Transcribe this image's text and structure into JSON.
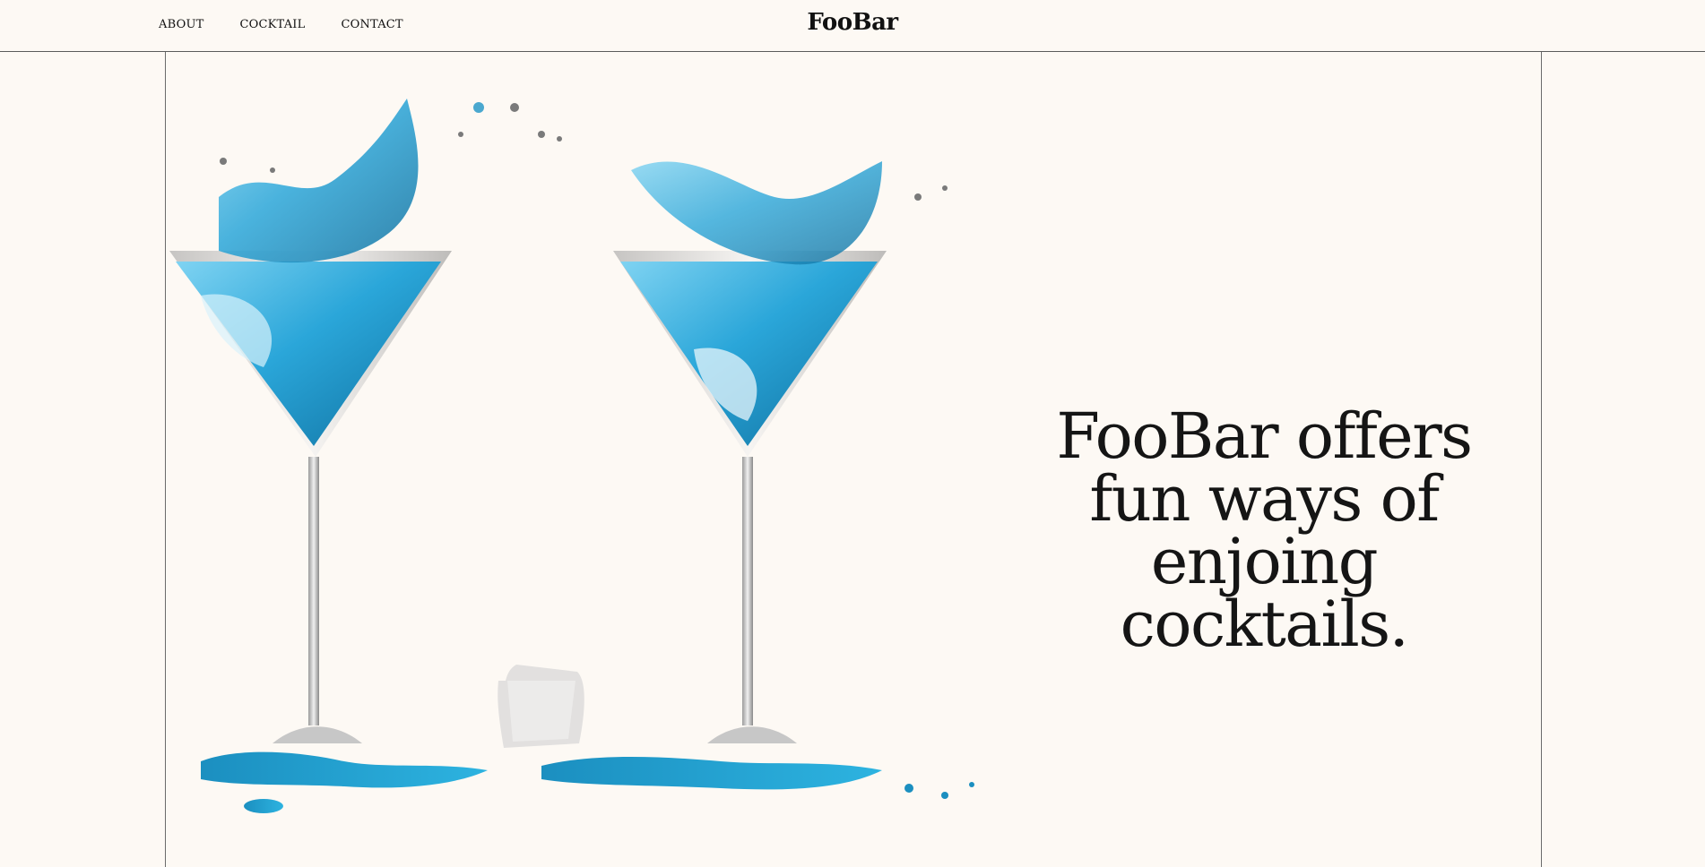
{
  "nav": {
    "items": [
      {
        "label": "ABOUT"
      },
      {
        "label": "COCKTAIL"
      },
      {
        "label": "CONTACT"
      }
    ]
  },
  "brand": "FooBar",
  "hero": {
    "headline": "FooBar offers fun ways of enjoing cocktails.",
    "image_name": "two-martini-glasses-splash-image"
  },
  "colors": {
    "background": "#fdf9f4",
    "text": "#111111",
    "divider": "#5b5b5b",
    "liquid": "#2aa6d9"
  }
}
